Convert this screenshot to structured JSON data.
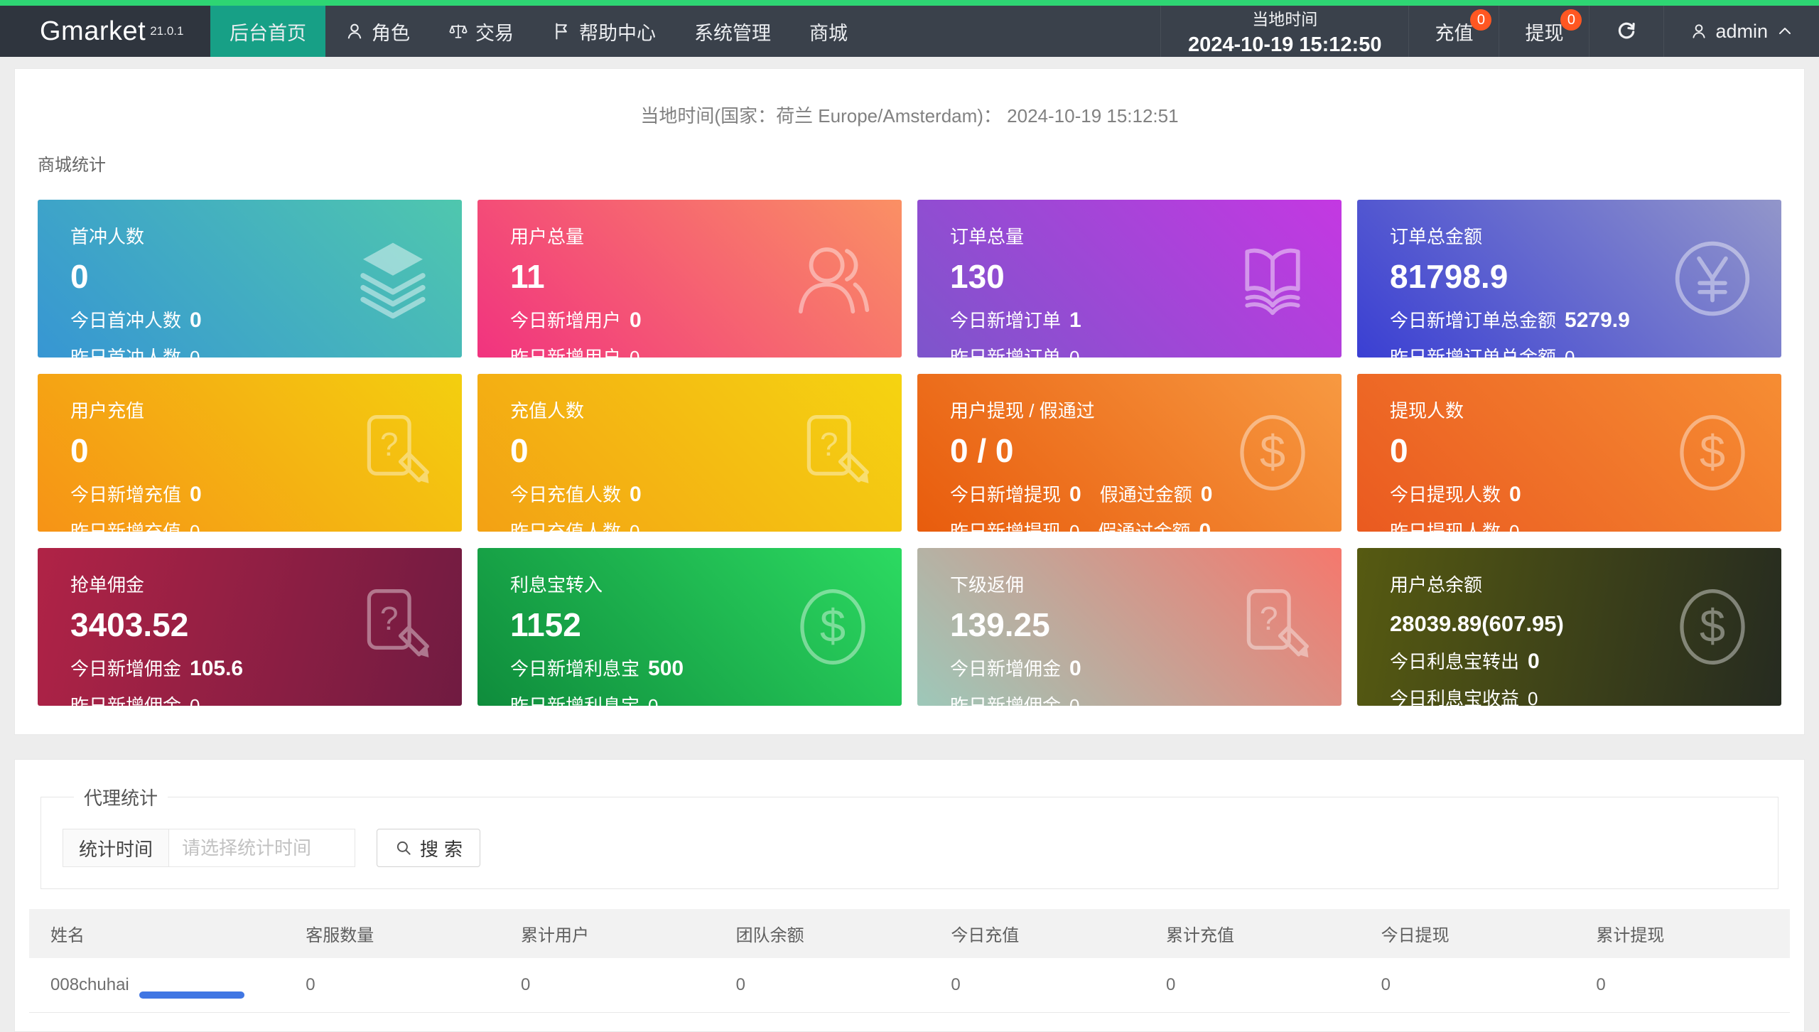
{
  "navbar": {
    "logo": "Gmarket",
    "version": "21.0.1",
    "menu": [
      {
        "id": "home",
        "label": "后台首页",
        "icon": null,
        "active": true
      },
      {
        "id": "roles",
        "label": "角色",
        "icon": "user-icon",
        "active": false
      },
      {
        "id": "trade",
        "label": "交易",
        "icon": "scales-icon",
        "active": false
      },
      {
        "id": "help",
        "label": "帮助中心",
        "icon": "flag-icon",
        "active": false
      },
      {
        "id": "system",
        "label": "系统管理",
        "icon": null,
        "active": false
      },
      {
        "id": "mall",
        "label": "商城",
        "icon": null,
        "active": false
      }
    ],
    "local_time_label": "当地时间",
    "local_time_value": "2024-10-19 15:12:50",
    "recharge": {
      "label": "充值",
      "badge": "0"
    },
    "withdraw": {
      "label": "提现",
      "badge": "0"
    },
    "user": "admin"
  },
  "overview": {
    "local_time_line": "当地时间(国家：荷兰 Europe/Amsterdam)：  2024-10-19 15:12:51",
    "section_title": "商城统计",
    "cards": [
      {
        "id": "first-recharge-users",
        "title": "首冲人数",
        "value": "0",
        "icon": "layers-icon",
        "gradient": {
          "angle": 45,
          "from": "#3796d3",
          "to": "#4fc7ae"
        },
        "lines": [
          [
            {
              "label": "今日首冲人数",
              "value": "0",
              "bold": true
            }
          ],
          [
            {
              "label": "昨日首冲人数",
              "value": "0",
              "bold": false
            }
          ]
        ]
      },
      {
        "id": "total-users",
        "title": "用户总量",
        "value": "11",
        "icon": "users-icon",
        "gradient": {
          "angle": 45,
          "from": "#f1337f",
          "to": "#fa9064"
        },
        "lines": [
          [
            {
              "label": "今日新增用户",
              "value": "0",
              "bold": true
            }
          ],
          [
            {
              "label": "昨日新增用户",
              "value": "0",
              "bold": false
            }
          ]
        ]
      },
      {
        "id": "total-orders",
        "title": "订单总量",
        "value": "130",
        "icon": "book-icon",
        "gradient": {
          "angle": 45,
          "from": "#7d55cb",
          "to": "#c438e2"
        },
        "lines": [
          [
            {
              "label": "今日新增订单",
              "value": "1",
              "bold": true
            }
          ],
          [
            {
              "label": "昨日新增订单",
              "value": "0",
              "bold": false
            }
          ]
        ]
      },
      {
        "id": "total-order-amount",
        "title": "订单总金额",
        "value": "81798.9",
        "icon": "yen-coin-icon",
        "gradient": {
          "angle": 45,
          "from": "#3a3fd3",
          "to": "#9296ca"
        },
        "lines": [
          [
            {
              "label": "今日新增订单总金额",
              "value": "5279.9",
              "bold": true
            }
          ],
          [
            {
              "label": "昨日新增订单总金额",
              "value": "0",
              "bold": false
            }
          ]
        ]
      },
      {
        "id": "user-recharge",
        "title": "用户充值",
        "value": "0",
        "icon": "doc-question-icon",
        "gradient": {
          "angle": 45,
          "from": "#f69316",
          "to": "#f3cf0f"
        },
        "lines": [
          [
            {
              "label": "今日新增充值",
              "value": "0",
              "bold": true
            }
          ],
          [
            {
              "label": "昨日新增充值",
              "value": "0",
              "bold": false
            }
          ]
        ]
      },
      {
        "id": "recharge-users",
        "title": "充值人数",
        "value": "0",
        "icon": "doc-question-icon",
        "gradient": {
          "angle": 45,
          "from": "#f3a114",
          "to": "#f5d411"
        },
        "lines": [
          [
            {
              "label": "今日充值人数",
              "value": "0",
              "bold": true
            }
          ],
          [
            {
              "label": "昨日充值人数",
              "value": "0",
              "bold": false
            }
          ]
        ]
      },
      {
        "id": "user-withdraw-fake",
        "title": "用户提现 / 假通过",
        "value": "0 / 0",
        "icon": "dollar-coin-icon",
        "gradient": {
          "angle": 45,
          "from": "#e85c0d",
          "to": "#f79941"
        },
        "lines": [
          [
            {
              "label": "今日新增提现",
              "value": "0",
              "bold": true
            },
            {
              "label": "假通过金额",
              "value": "0",
              "bold": true
            }
          ],
          [
            {
              "label": "昨日新增提现",
              "value": "0",
              "bold": false
            },
            {
              "label": "假通过金额",
              "value": "0",
              "bold": true
            }
          ]
        ]
      },
      {
        "id": "withdraw-users",
        "title": "提现人数",
        "value": "0",
        "icon": "dollar-coin-icon",
        "gradient": {
          "angle": 45,
          "from": "#ea5a20",
          "to": "#f68d33"
        },
        "lines": [
          [
            {
              "label": "今日提现人数",
              "value": "0",
              "bold": true
            }
          ],
          [
            {
              "label": "昨日提现人数",
              "value": "0",
              "bold": false
            }
          ]
        ]
      },
      {
        "id": "grab-commission",
        "title": "抢单佣金",
        "value": "3403.52",
        "icon": "doc-question-icon",
        "gradient": {
          "angle": 105,
          "from": "#b02346",
          "to": "#701b41"
        },
        "lines": [
          [
            {
              "label": "今日新增佣金",
              "value": "105.6",
              "bold": true
            }
          ],
          [
            {
              "label": "昨日新增佣金",
              "value": "0",
              "bold": false
            }
          ]
        ]
      },
      {
        "id": "lixibao-in",
        "title": "利息宝转入",
        "value": "1152",
        "icon": "dollar-coin-icon",
        "gradient": {
          "angle": 45,
          "from": "#0f8c3c",
          "to": "#2cda61"
        },
        "lines": [
          [
            {
              "label": "今日新增利息宝",
              "value": "500",
              "bold": true
            }
          ],
          [
            {
              "label": "昨日新增利息宝",
              "value": "0",
              "bold": false
            }
          ]
        ]
      },
      {
        "id": "sub-rebate",
        "title": "下级返佣",
        "value": "139.25",
        "icon": "doc-question-icon",
        "gradient": {
          "angle": 45,
          "from": "#9dc8b9",
          "to": "#f5786d"
        },
        "lines": [
          [
            {
              "label": "今日新增佣金",
              "value": "0",
              "bold": true
            }
          ],
          [
            {
              "label": "昨日新增佣金",
              "value": "0",
              "bold": false
            }
          ]
        ]
      },
      {
        "id": "user-total-balance",
        "title": "用户总余额",
        "value": "28039.89(607.95)",
        "value_small": true,
        "icon": "dollar-coin-icon",
        "gradient": {
          "angle": 100,
          "from": "#565a11",
          "to": "#262b20"
        },
        "lines": [
          [
            {
              "label": "今日利息宝转出",
              "value": "0",
              "bold": true
            }
          ],
          [
            {
              "label": "今日利息宝收益",
              "value": "0",
              "bold": false
            }
          ]
        ]
      }
    ]
  },
  "agent_stats": {
    "legend": "代理统计",
    "filter_label": "统计时间",
    "filter_placeholder": "请选择统计时间",
    "search_label": "搜索",
    "table": {
      "headers": [
        "姓名",
        "客服数量",
        "累计用户",
        "团队余额",
        "今日充值",
        "累计充值",
        "今日提现",
        "累计提现"
      ],
      "rows": [
        [
          "008chuhai",
          "0",
          "0",
          "0",
          "0",
          "0",
          "0",
          "0"
        ]
      ]
    }
  },
  "colors": {
    "top_line": "#2ed573",
    "navbar_bg": "#3a414b",
    "active_tab": "#17a086",
    "badge": "#ff5722",
    "page_bg": "#ededed"
  }
}
